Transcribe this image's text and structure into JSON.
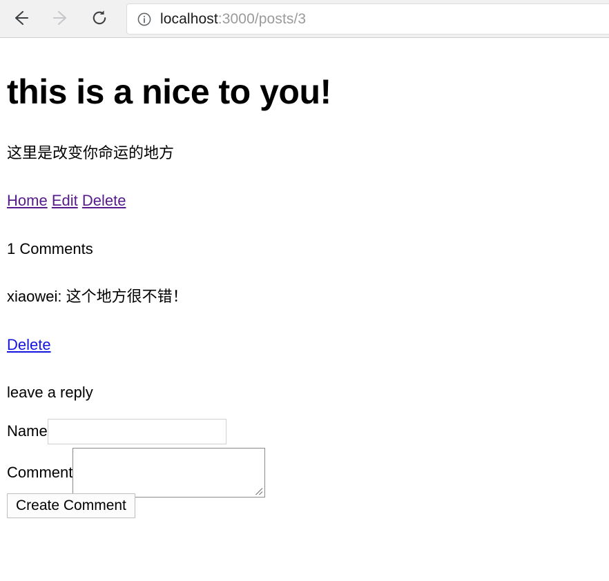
{
  "browser": {
    "back_label": "Back",
    "forward_label": "Forward",
    "reload_label": "Reload",
    "site_info_label": "Site information",
    "url_host": "localhost",
    "url_rest": ":3000/posts/3",
    "url_full": "localhost:3000/posts/3"
  },
  "post": {
    "title": "this is a nice to you!",
    "body": "这里是改变你命运的地方",
    "links": [
      {
        "label": "Home",
        "state": "visited"
      },
      {
        "label": "Edit",
        "state": "visited"
      },
      {
        "label": "Delete",
        "state": "visited"
      }
    ]
  },
  "comments": {
    "count_label": "1 Comments",
    "items": [
      {
        "author": "xiaowei",
        "text": "这个地方很不错！",
        "display": "xiaowei: 这个地方很不错！",
        "delete_label": "Delete"
      }
    ]
  },
  "form": {
    "heading": "leave a reply",
    "name_label": "Name",
    "name_value": "",
    "name_placeholder": "",
    "comment_label": "Comment",
    "comment_value": "",
    "comment_placeholder": "",
    "submit_label": "Create Comment"
  },
  "colors": {
    "visited_link": "#551a8b",
    "unvisited_link": "#1414e0",
    "toolbar_bg": "#f1f1f2",
    "page_bg": "#ffffff",
    "text": "#000000"
  }
}
